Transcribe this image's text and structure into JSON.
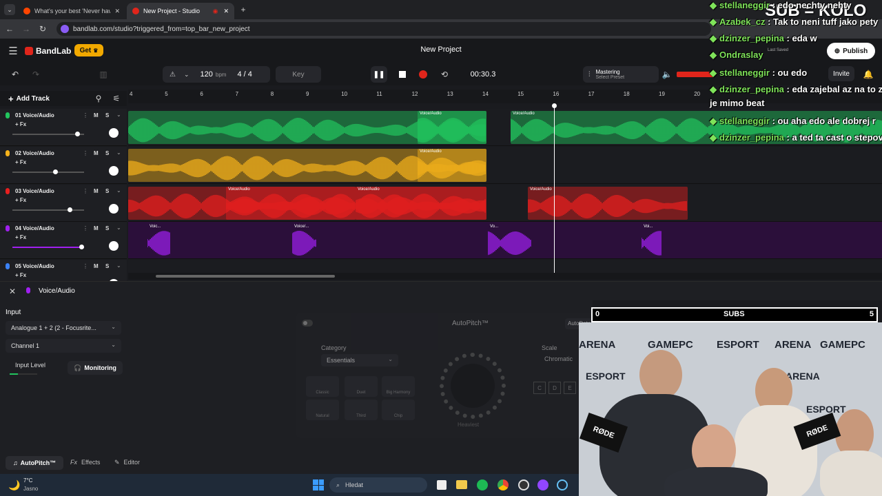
{
  "browser": {
    "tabs": [
      {
        "label": "What's your best 'Never have I",
        "active": false
      },
      {
        "label": "New Project - Studio",
        "active": true
      }
    ],
    "url": "bandlab.com/studio?triggered_from=top_bar_new_project"
  },
  "app": {
    "brand": "BandLab",
    "get_label": "Get",
    "project_title": "New Project",
    "publish_label": "Publish",
    "invite_label": "Invite",
    "last_saved": "Last Saved"
  },
  "toolbar": {
    "bpm_value": "120",
    "bpm_unit": "bpm",
    "time_sig": "4 / 4",
    "key_label": "Key",
    "time": "00:30.3",
    "mastering_label": "Mastering",
    "mastering_sub": "Select Preset"
  },
  "tracklist": {
    "add_track": "Add Track"
  },
  "ruler": {
    "ticks": [
      "4",
      "5",
      "6",
      "7",
      "8",
      "9",
      "10",
      "11",
      "12",
      "13",
      "14",
      "15",
      "16",
      "17",
      "18",
      "19",
      "20"
    ]
  },
  "tracks": [
    {
      "name": "01 Voice/Audio",
      "fx": "+ Fx",
      "m": "M",
      "s": "S",
      "color": "#22c55e",
      "vol": 0.9,
      "clip_label": "Voice/Audio"
    },
    {
      "name": "02 Voice/Audio",
      "fx": "+ Fx",
      "m": "M",
      "s": "S",
      "color": "#f5b21b",
      "vol": 0.6,
      "clip_label": "Voice/Audio"
    },
    {
      "name": "03 Voice/Audio",
      "fx": "+ Fx",
      "m": "M",
      "s": "S",
      "color": "#e81f1f",
      "vol": 0.8,
      "clip_label": "Voice/Audio"
    },
    {
      "name": "04 Voice/Audio",
      "fx": "+ Fx",
      "m": "M",
      "s": "S",
      "color": "#a020f0",
      "vol": 0.96,
      "clip_label": "Voice/Audio"
    },
    {
      "name": "05 Voice/Audio",
      "fx": "+ Fx",
      "m": "M",
      "s": "S",
      "color": "#3b82f6",
      "vol": 0.5,
      "clip_label": ""
    }
  ],
  "clip_labels": {
    "voice_audio": "Voice/Audio",
    "voi_short": "Voic...",
    "voi_dots": "Voice/...",
    "vo": "Vo...",
    "voi": "Voi..."
  },
  "panel": {
    "title": "Voice/Audio",
    "input_heading": "Input",
    "input_select": "Analogue 1 + 2 (2 - Focusrite...",
    "channel_select": "Channel 1",
    "input_level_label": "Input Level",
    "monitoring_label": "Monitoring",
    "autopitch_title": "AutoPitch™",
    "category_label": "Category",
    "category_value": "Essentials",
    "scale_label": "Scale",
    "scale_value": "Chromatic",
    "heaviest_label": "Heaviest",
    "autodetect_label": "AutoDetect Key",
    "modes": [
      "Classic",
      "Duet",
      "Big Harmony",
      "Natural",
      "Third",
      "Chip"
    ],
    "notes": [
      "C",
      "D",
      "E"
    ],
    "tabs": [
      "AutoPitch™",
      "Effects",
      "Editor"
    ]
  },
  "taskbar": {
    "temp": "7°C",
    "weather": "Jasno",
    "search_placeholder": "Hledat"
  },
  "chat": [
    {
      "user": "stellaneggir",
      "msg": ": edo nechty nehty"
    },
    {
      "user": "Azabek_cz",
      "msg": ": Tak to neni tuff jako pety"
    },
    {
      "user": "dzinzer_pepina",
      "msg": ": eda w"
    },
    {
      "user": "Ondraslay",
      "msg": ""
    },
    {
      "user": "stellaneggir",
      "msg": ": ou edo"
    },
    {
      "user": "dzinzer_pepina",
      "msg": ": eda zajebal az na to z"
    },
    {
      "user": "",
      "msg": "je mimo beat"
    },
    {
      "user": "stellaneggir",
      "msg": ": ou aha edo ale dobrej r"
    },
    {
      "user": "dzinzer_pepina",
      "msg": ": a ted ta cast o stepov"
    }
  ],
  "overlay": {
    "sub_kolo": "SUB = KOLO",
    "subs_label": "SUBS",
    "subs_min": "0",
    "subs_max": "5",
    "cam_text": [
      "ARENA",
      "GAMEPC",
      "ESPORT",
      "ARENA",
      "GAMEPC",
      "ESPORT",
      "ARENA",
      "ESPORT"
    ],
    "mic_brand": "RØDE"
  },
  "colors": {
    "accent": "#f2a900",
    "record": "#e0251b",
    "bg": "#1a1b1f"
  }
}
